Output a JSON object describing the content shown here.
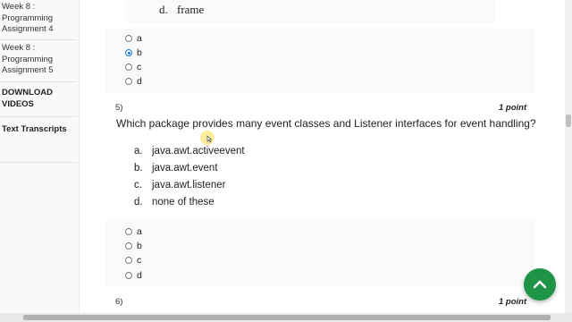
{
  "sidebar": {
    "items": [
      {
        "line1": "Week 8 :",
        "line2": "Programming",
        "line3": "Assignment 4"
      },
      {
        "line1": "Week 8 :",
        "line2": "Programming",
        "line3": "Assignment 5"
      }
    ],
    "download_line1": "DOWNLOAD",
    "download_line2": "VIDEOS",
    "transcripts": "Text Transcripts"
  },
  "prev_question": {
    "last_choice_letter": "d.",
    "last_choice_text": "frame",
    "options": [
      "a",
      "b",
      "c",
      "d"
    ],
    "selected": "b"
  },
  "question5": {
    "number": "5)",
    "points": "1 point",
    "text": "Which package provides many event classes and Listener interfaces for event handling?",
    "choices": [
      {
        "letter": "a.",
        "text": "java.awt.activeevent"
      },
      {
        "letter": "b.",
        "text": "java.awt.event"
      },
      {
        "letter": "c.",
        "text": "java.awt.listener"
      },
      {
        "letter": "d.",
        "text": "none of these"
      }
    ],
    "options": [
      "a",
      "b",
      "c",
      "d"
    ]
  },
  "question6": {
    "number": "6)",
    "points": "1 point"
  },
  "fab": {
    "icon": "chevron-up-icon",
    "color": "#1e9446"
  },
  "accent_color": "#1a73e8"
}
